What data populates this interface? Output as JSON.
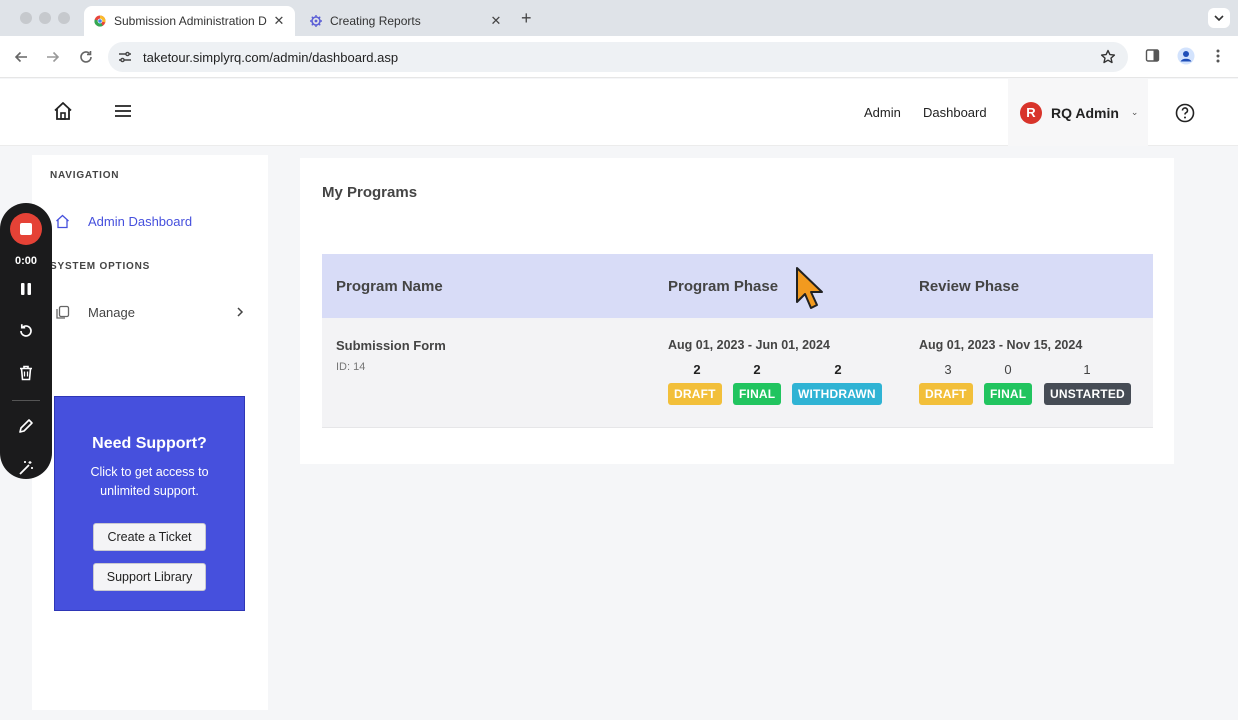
{
  "browser": {
    "tabs": [
      {
        "title": "Submission Administration D",
        "active": true
      },
      {
        "title": "Creating Reports",
        "active": false
      }
    ],
    "url": "taketour.simplyrq.com/admin/dashboard.asp"
  },
  "header": {
    "nav_admin": "Admin",
    "nav_dashboard": "Dashboard",
    "user_initial": "R",
    "user_name": "RQ Admin"
  },
  "sidebar": {
    "navigation_heading": "NAVIGATION",
    "admin_dashboard": "Admin Dashboard",
    "system_options_heading": "SYSTEM OPTIONS",
    "manage": "Manage",
    "support": {
      "title": "Need Support?",
      "text": "Click to get access to unlimited support.",
      "create_ticket": "Create a Ticket",
      "support_library": "Support Library"
    }
  },
  "recorder": {
    "time": "0:00"
  },
  "main": {
    "title": "My Programs",
    "columns": [
      "Program Name",
      "Program Phase",
      "Review Phase"
    ],
    "program": {
      "name": "Submission Form",
      "id": "ID: 14",
      "program_phase": {
        "dates": "Aug 01, 2023 - Jun 01, 2024",
        "draft": "2",
        "final": "2",
        "withdrawn": "2"
      },
      "review_phase": {
        "dates": "Aug 01, 2023 - Nov 15, 2024",
        "draft": "3",
        "final": "0",
        "unstarted": "1"
      }
    },
    "badges": {
      "draft": "DRAFT",
      "final": "FINAL",
      "withdrawn": "WITHDRAWN",
      "unstarted": "UNSTARTED"
    }
  },
  "colors": {
    "accent": "#4650dd",
    "draft": "#f2bf3a",
    "final": "#21c45f",
    "withdrawn": "#2fb3d4",
    "unstarted": "#464c55",
    "record": "#e54236"
  }
}
